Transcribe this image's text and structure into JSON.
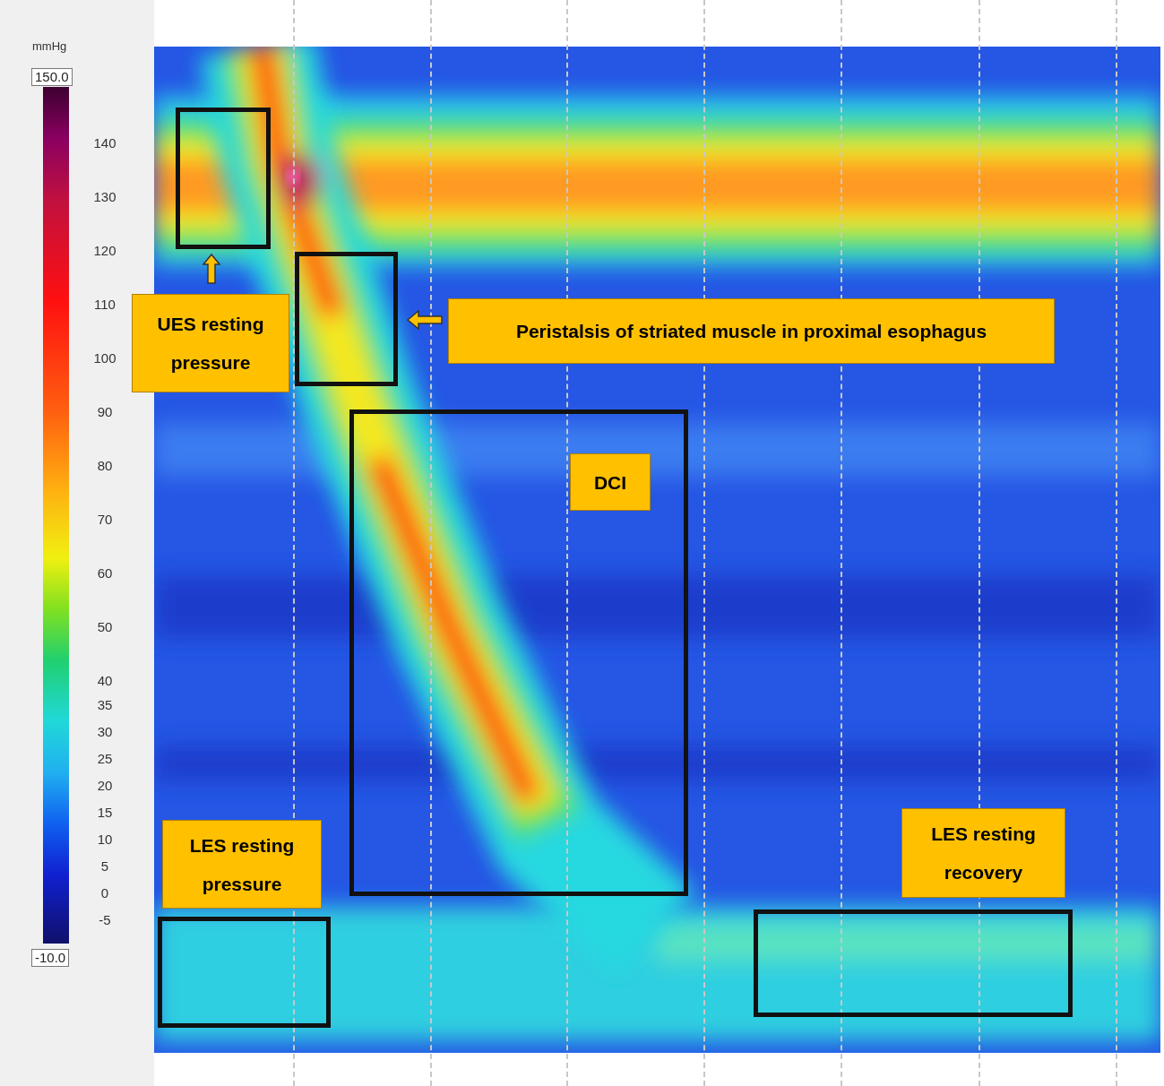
{
  "colorbar": {
    "unit": "mmHg",
    "max": "150.0",
    "min": "-10.0",
    "ticks": [
      "140",
      "130",
      "120",
      "110",
      "100",
      "90",
      "80",
      "70",
      "60",
      "50",
      "40",
      "35",
      "30",
      "25",
      "20",
      "15",
      "10",
      "5",
      "0",
      "-5"
    ]
  },
  "annotations": [
    {
      "kind": "box"
    },
    {
      "kind": "box"
    },
    {
      "kind": "box"
    },
    {
      "kind": "box"
    },
    {
      "kind": "box"
    },
    {
      "kind": "label",
      "lines": [
        "UES resting",
        "pressure"
      ]
    },
    {
      "kind": "label",
      "lines": [
        "Peristalsis of striated muscle in proximal esophagus"
      ]
    },
    {
      "kind": "label",
      "lines": [
        "DCI"
      ]
    },
    {
      "kind": "label",
      "lines": [
        "LES resting",
        "pressure"
      ]
    },
    {
      "kind": "label",
      "lines": [
        "LES resting",
        "recovery"
      ]
    },
    {
      "kind": "arrow-up"
    },
    {
      "kind": "arrow-left"
    }
  ]
}
